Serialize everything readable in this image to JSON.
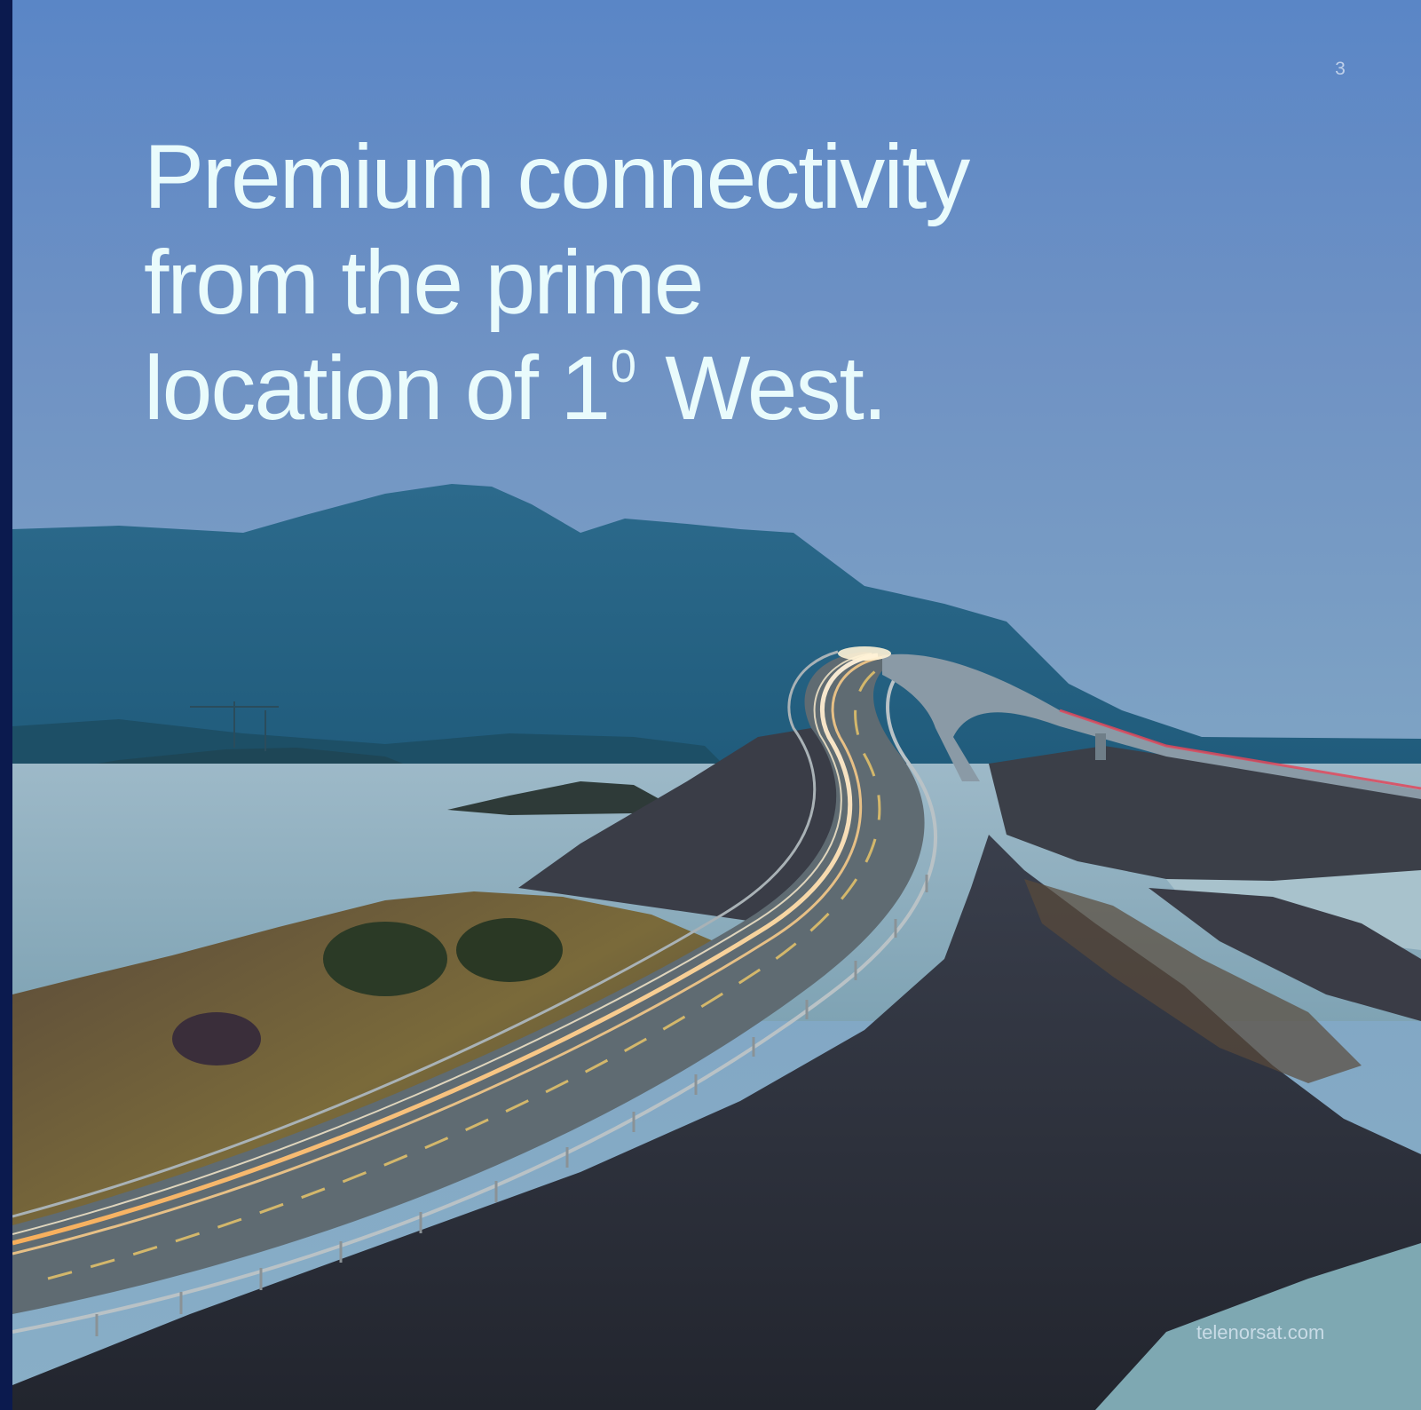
{
  "page": {
    "number": "3",
    "footer_url": "telenorsat.com"
  },
  "headline": {
    "line1": "Premium connectivity",
    "line2": "from the prime",
    "line3_pre": "location of 1",
    "line3_sup": "0",
    "line3_post": " West."
  },
  "colors": {
    "sidebar": "#0b1a4e",
    "sky_top": "#5a86c6",
    "headline_text": "#e9fbfc"
  }
}
